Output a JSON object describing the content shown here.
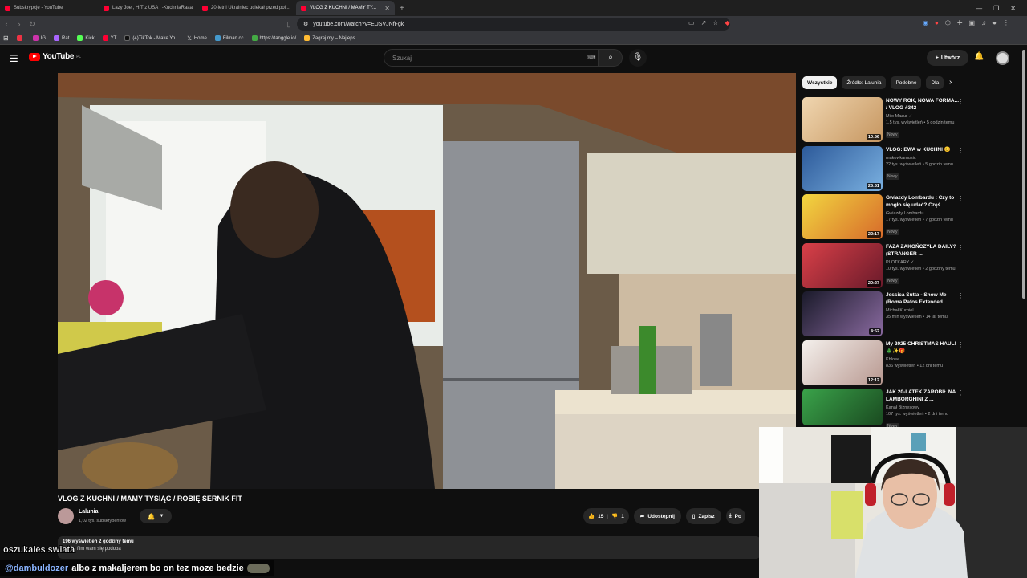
{
  "browser": {
    "tabs": [
      {
        "title": "Subskrypcje - YouTube",
        "active": false
      },
      {
        "title": "Lazy Joe , HIT z USA ! -KuchniaRaaa",
        "active": false
      },
      {
        "title": "20-letni Ukrainiec uciekał przed poli...",
        "active": false
      },
      {
        "title": "VLOG Z KUCHNI / MAMY TY...",
        "active": true
      }
    ],
    "url": "youtube.com/watch?v=EUSVJNfFgk",
    "bookmarks": [
      {
        "label": "",
        "color": "#e34"
      },
      {
        "label": "IG",
        "color": "#c3a"
      },
      {
        "label": "Rat",
        "color": "#a6f"
      },
      {
        "label": "Kick",
        "color": "#5f5"
      },
      {
        "label": "YT",
        "color": "#f03"
      },
      {
        "label": "(4)TikTok - Make Yo...",
        "color": "#111"
      },
      {
        "label": "Home",
        "color": "#000"
      },
      {
        "label": "Filman.cc",
        "color": "#49c"
      },
      {
        "label": "https://tanggle.io/",
        "color": "#4a4"
      },
      {
        "label": "Zagraj.my – Najleps...",
        "color": "#fb3"
      }
    ]
  },
  "youtube": {
    "logo_text": "YouTube",
    "logo_region": "PL",
    "search_placeholder": "Szukaj",
    "create_label": "Utwórz"
  },
  "video": {
    "title": "VLOG Z KUCHNI / MAMY TYSIĄC / ROBIĘ SERNIK FIT",
    "channel": "Lalunia",
    "subscribers": "1,02 tys. subskrybentów",
    "likes": "15",
    "dislikes": "1",
    "share_label": "Udostępnij",
    "save_label": "Zapisz",
    "download_label": "Po",
    "views_time": "196 wyświetleń  2 godziny temu",
    "description": "...ę że film wam się podoba"
  },
  "sidebar": {
    "chips": [
      "Wszystkie",
      "Źródło: Lalunia",
      "Podobne",
      "Dla"
    ],
    "recommendations": [
      {
        "title": "NOWY ROK, NOWA FORMA... / VLOG #342",
        "channel": "Milo Mazur",
        "meta": "1,5 tys. wyświetleń • 5 godzin temu",
        "badge": "Nowy",
        "duration": "10:56",
        "thumb_color": "#d9b48a"
      },
      {
        "title": "VLOG: EWA w KUCHNI 😊",
        "channel": "makowkamusic",
        "meta": "22 tys. wyświetleń • 5 godzin temu",
        "badge": "Nowy",
        "duration": "25:51",
        "thumb_color": "#3b6aa6"
      },
      {
        "title": "Gwiazdy Lombardu : Czy to mogło się udać? Częś...",
        "channel": "Gwiazdy Lombardu",
        "meta": "17 tys. wyświetleń • 7 godzin temu",
        "badge": "Nowy",
        "duration": "22:17",
        "thumb_color": "#e7c53a"
      },
      {
        "title": "FAZA ZAKOŃCZYŁA DAILY? (STRANGER ...",
        "channel": "PLOTKARY",
        "meta": "10 tys. wyświetleń • 2 godziny temu",
        "badge": "Nowy",
        "duration": "20:27",
        "thumb_color": "#c2363a"
      },
      {
        "title": "Jessica Sutta - Show Me (Roma Pafos Extended ...",
        "channel": "Michał Kurpiel",
        "meta": "35 min wyświetleń • 14 lat temu",
        "badge": "",
        "duration": "4:52",
        "thumb_color": "#5a4560"
      },
      {
        "title": "My 2025 CHRISTMAS HAUL! 🎄✨🎁",
        "channel": "Khloee",
        "meta": "836 wyświetleń • 12 dni temu",
        "badge": "",
        "duration": "12:12",
        "thumb_color": "#e9e4df"
      },
      {
        "title": "JAK 20-LATEK ZAROBIŁ NA LAMBORGHINI Z ...",
        "channel": "Kanał Biznesowy",
        "meta": "107 tys. wyświetleń • 2 dni temu",
        "badge": "Nowy",
        "duration": "",
        "thumb_color": "#3aa34a"
      }
    ]
  },
  "chat": {
    "line1": "oszukales swiata",
    "line2_user": "@dambuldozer",
    "line2_text": "albo z makaljerem bo on tez moze bedzie"
  }
}
